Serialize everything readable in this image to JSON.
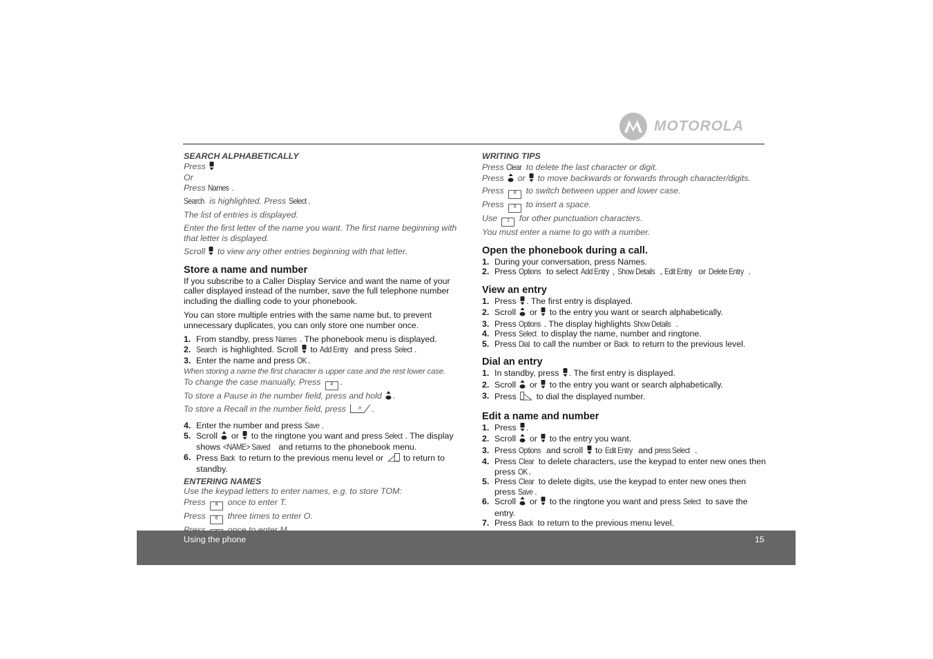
{
  "logo": {
    "text": "MOTOROLA"
  },
  "footer": {
    "section": "Using the phone",
    "page": "15"
  },
  "left": [
    {
      "type": "sub",
      "seg": [
        {
          "t": "SEARCH ALPHABETICALLY"
        }
      ]
    },
    {
      "type": "note",
      "seg": [
        {
          "t": "Press "
        },
        {
          "i": "scroll-down"
        }
      ]
    },
    {
      "type": "note",
      "seg": [
        {
          "t": "Or"
        }
      ]
    },
    {
      "type": "note",
      "seg": [
        {
          "t": "Press "
        },
        {
          "k": "Names"
        },
        {
          "t": "."
        }
      ]
    },
    {
      "type": "note-sep",
      "seg": [
        {
          "k": "Search"
        },
        {
          "t": " is highlighted. Press "
        },
        {
          "k": "Select"
        },
        {
          "t": "."
        }
      ]
    },
    {
      "type": "note-sep",
      "seg": [
        {
          "t": "The list of entries is displayed."
        }
      ]
    },
    {
      "type": "note-sep",
      "seg": [
        {
          "t": "Enter the first letter of the name you want. The first name beginning with that letter is displayed."
        }
      ]
    },
    {
      "type": "note-sep",
      "seg": [
        {
          "t": "Scroll "
        },
        {
          "i": "scroll-down"
        },
        {
          "t": " to view any other entries beginning with that letter."
        }
      ]
    },
    {
      "type": "h",
      "seg": [
        {
          "t": "Store a name and number"
        }
      ]
    },
    {
      "type": "p",
      "seg": [
        {
          "t": "If you subscribe to a Caller Display Service and want the name of your caller displayed instead of the number, save the full telephone number including the dialling code to your phonebook."
        }
      ]
    },
    {
      "type": "p-sep",
      "seg": [
        {
          "t": "You can store multiple entries with the same name but, to prevent unnecessary duplicates, you can only store one number once."
        }
      ]
    },
    {
      "type": "li-sep",
      "num": "1.",
      "seg": [
        {
          "t": "From standby, press "
        },
        {
          "k": "Names"
        },
        {
          "t": ". The phonebook menu is displayed."
        }
      ]
    },
    {
      "type": "li",
      "num": "2.",
      "seg": [
        {
          "k": "Search"
        },
        {
          "t": " is highlighted. Scroll "
        },
        {
          "i": "scroll-down"
        },
        {
          "t": " to "
        },
        {
          "k": "Add Entry"
        },
        {
          "t": " and press "
        },
        {
          "k": "Select"
        },
        {
          "t": "."
        }
      ]
    },
    {
      "type": "li",
      "num": "3.",
      "seg": [
        {
          "t": "Enter the name and press "
        },
        {
          "k": "OK"
        },
        {
          "t": "."
        }
      ]
    },
    {
      "type": "note-small",
      "seg": [
        {
          "t": "When storing a name the first character is upper case and the rest lower case."
        }
      ]
    },
    {
      "type": "note-key",
      "seg": [
        {
          "t": "To change the case manually, Press "
        },
        {
          "i": "key",
          "label": "#"
        },
        {
          "t": "."
        }
      ]
    },
    {
      "type": "note-key",
      "seg": [
        {
          "t": "To store a Pause in the number field, press and hold "
        },
        {
          "i": "scroll-up"
        },
        {
          "t": "."
        }
      ]
    },
    {
      "type": "note-key",
      "seg": [
        {
          "t": "To store a Recall in the number field, press "
        },
        {
          "i": "recall-key"
        },
        {
          "t": "."
        }
      ]
    },
    {
      "type": "li-sep",
      "num": "4.",
      "seg": [
        {
          "t": "Enter the number and press "
        },
        {
          "k": "Save"
        },
        {
          "t": "."
        }
      ]
    },
    {
      "type": "li",
      "num": "5.",
      "seg": [
        {
          "t": "Scroll "
        },
        {
          "i": "scroll-up"
        },
        {
          "t": " or "
        },
        {
          "i": "scroll-down"
        },
        {
          "t": " to the ringtone you want and press "
        },
        {
          "k": "Select"
        },
        {
          "t": ". The display shows "
        },
        {
          "k": "<NAME> Saved"
        },
        {
          "t": " and returns to the phonebook menu."
        }
      ]
    },
    {
      "type": "li",
      "num": "6.",
      "seg": [
        {
          "t": "Press "
        },
        {
          "k": "Back"
        },
        {
          "t": " to return to the previous menu level or "
        },
        {
          "i": "end-call"
        },
        {
          "t": " to return to standby."
        }
      ]
    },
    {
      "type": "sub-sep",
      "seg": [
        {
          "t": "ENTERING NAMES"
        }
      ]
    },
    {
      "type": "note",
      "seg": [
        {
          "t": "Use the keypad letters to enter names, e.g. to store TOM:"
        }
      ]
    },
    {
      "type": "note-key16",
      "seg": [
        {
          "t": "Press "
        },
        {
          "i": "key",
          "label": "8"
        },
        {
          "t": " once to enter T."
        }
      ]
    },
    {
      "type": "note-key16",
      "seg": [
        {
          "t": "Press "
        },
        {
          "i": "key",
          "label": "6"
        },
        {
          "t": " three times to enter O."
        }
      ]
    },
    {
      "type": "note-key16",
      "seg": [
        {
          "t": "Press "
        },
        {
          "i": "key",
          "label": "6"
        },
        {
          "t": " once to enter M."
        }
      ]
    }
  ],
  "right": [
    {
      "type": "sub",
      "seg": [
        {
          "t": "WRITING TIPS"
        }
      ]
    },
    {
      "type": "note-key16",
      "seg": [
        {
          "t": "Press "
        },
        {
          "k": "Clear"
        },
        {
          "t": " to delete the last character or digit."
        }
      ]
    },
    {
      "type": "note-key16",
      "seg": [
        {
          "t": "Press "
        },
        {
          "i": "scroll-up"
        },
        {
          "t": " or "
        },
        {
          "i": "scroll-down"
        },
        {
          "t": " to move backwards or forwards through character/digits."
        }
      ]
    },
    {
      "type": "note-key16",
      "seg": [
        {
          "t": "Press "
        },
        {
          "i": "key",
          "label": "#"
        },
        {
          "t": " to switch between upper and lower case."
        }
      ]
    },
    {
      "type": "note-key16",
      "seg": [
        {
          "t": "Press "
        },
        {
          "i": "key",
          "label": "0"
        },
        {
          "t": " to insert a space."
        }
      ]
    },
    {
      "type": "note-key16",
      "seg": [
        {
          "t": "Use "
        },
        {
          "i": "key",
          "label": "1"
        },
        {
          "t": " for other punctuation characters."
        }
      ]
    },
    {
      "type": "note-key16",
      "seg": [
        {
          "t": "You must enter a name to go with a number."
        }
      ]
    },
    {
      "type": "h-big",
      "seg": [
        {
          "t": "Open the phonebook during a call."
        }
      ]
    },
    {
      "type": "li",
      "num": "1.",
      "seg": [
        {
          "t": "During your conversation, press Names."
        }
      ]
    },
    {
      "type": "li",
      "num": "2.",
      "seg": [
        {
          "t": "Press "
        },
        {
          "k": "Options"
        },
        {
          "t": " to select "
        },
        {
          "k": "Add Entry"
        },
        {
          "t": ", "
        },
        {
          "k": "Show Details"
        },
        {
          "t": ", "
        },
        {
          "k": "Edit Entry"
        },
        {
          "t": " or "
        },
        {
          "k": "Delete Entry"
        },
        {
          "t": "."
        }
      ]
    },
    {
      "type": "h-big",
      "seg": [
        {
          "t": "View an entry"
        }
      ]
    },
    {
      "type": "li",
      "num": "1.",
      "seg": [
        {
          "t": "Press "
        },
        {
          "i": "scroll-down"
        },
        {
          "t": ". The first entry is displayed."
        }
      ]
    },
    {
      "type": "li",
      "num": "2.",
      "seg": [
        {
          "t": "Scroll "
        },
        {
          "i": "scroll-up"
        },
        {
          "t": " or "
        },
        {
          "i": "scroll-down"
        },
        {
          "t": " to the entry you want or search alphabetically."
        }
      ]
    },
    {
      "type": "li",
      "num": "3.",
      "seg": [
        {
          "t": "Press "
        },
        {
          "k": "Options"
        },
        {
          "t": ". The display highlights "
        },
        {
          "k": "Show Details"
        },
        {
          "t": "."
        }
      ]
    },
    {
      "type": "li",
      "num": "4.",
      "seg": [
        {
          "t": "Press "
        },
        {
          "k": "Select"
        },
        {
          "t": " to display the name, number and ringtone."
        }
      ]
    },
    {
      "type": "li",
      "num": "5.",
      "seg": [
        {
          "t": "Press "
        },
        {
          "k": "Dial"
        },
        {
          "t": " to call the number or "
        },
        {
          "k": "Back"
        },
        {
          "t": " to return to the previous level."
        }
      ]
    },
    {
      "type": "h-big",
      "seg": [
        {
          "t": "Dial an entry"
        }
      ]
    },
    {
      "type": "li",
      "num": "1.",
      "seg": [
        {
          "t": "In standby, press "
        },
        {
          "i": "scroll-down"
        },
        {
          "t": ". The first entry is displayed."
        }
      ]
    },
    {
      "type": "li",
      "num": "2.",
      "seg": [
        {
          "t": "Scroll "
        },
        {
          "i": "scroll-up"
        },
        {
          "t": " or "
        },
        {
          "i": "scroll-down"
        },
        {
          "t": " to the entry you want or search alphabetically."
        }
      ]
    },
    {
      "type": "li",
      "num": "3.",
      "seg": [
        {
          "t": "Press "
        },
        {
          "i": "talk-key"
        },
        {
          "t": " to dial the displayed number."
        }
      ]
    },
    {
      "type": "h-big",
      "seg": [
        {
          "t": "Edit a name and number"
        }
      ]
    },
    {
      "type": "li",
      "num": "1.",
      "seg": [
        {
          "t": "Press "
        },
        {
          "i": "scroll-down"
        },
        {
          "t": "."
        }
      ]
    },
    {
      "type": "li",
      "num": "2.",
      "seg": [
        {
          "t": "Scroll "
        },
        {
          "i": "scroll-up"
        },
        {
          "t": " or "
        },
        {
          "i": "scroll-down"
        },
        {
          "t": " to the entry you want."
        }
      ]
    },
    {
      "type": "li",
      "num": "3.",
      "seg": [
        {
          "t": "Press "
        },
        {
          "k": "Options"
        },
        {
          "t": " and scroll "
        },
        {
          "i": "scroll-down"
        },
        {
          "t": " to "
        },
        {
          "k": "Edit Entry"
        },
        {
          "t": " and "
        },
        {
          "k": "press Select"
        },
        {
          "t": "."
        }
      ]
    },
    {
      "type": "li",
      "num": "4.",
      "seg": [
        {
          "t": "Press "
        },
        {
          "k": "Clear"
        },
        {
          "t": " to delete characters, use the keypad to enter new ones then press "
        },
        {
          "k": "OK"
        },
        {
          "t": "."
        }
      ]
    },
    {
      "type": "li",
      "num": "5.",
      "seg": [
        {
          "t": "Press "
        },
        {
          "k": "Clear"
        },
        {
          "t": " to delete digits, use the keypad to enter new ones then press "
        },
        {
          "k": "Save"
        },
        {
          "t": "."
        }
      ]
    },
    {
      "type": "li",
      "num": "6.",
      "seg": [
        {
          "t": "Scroll "
        },
        {
          "i": "scroll-up"
        },
        {
          "t": " or "
        },
        {
          "i": "scroll-down"
        },
        {
          "t": " to the ringtone you want and press "
        },
        {
          "k": "Select"
        },
        {
          "t": " to save the entry."
        }
      ]
    },
    {
      "type": "li",
      "num": "7.",
      "seg": [
        {
          "t": "Press "
        },
        {
          "k": "Back"
        },
        {
          "t": " to return to the previous menu level."
        }
      ]
    }
  ]
}
